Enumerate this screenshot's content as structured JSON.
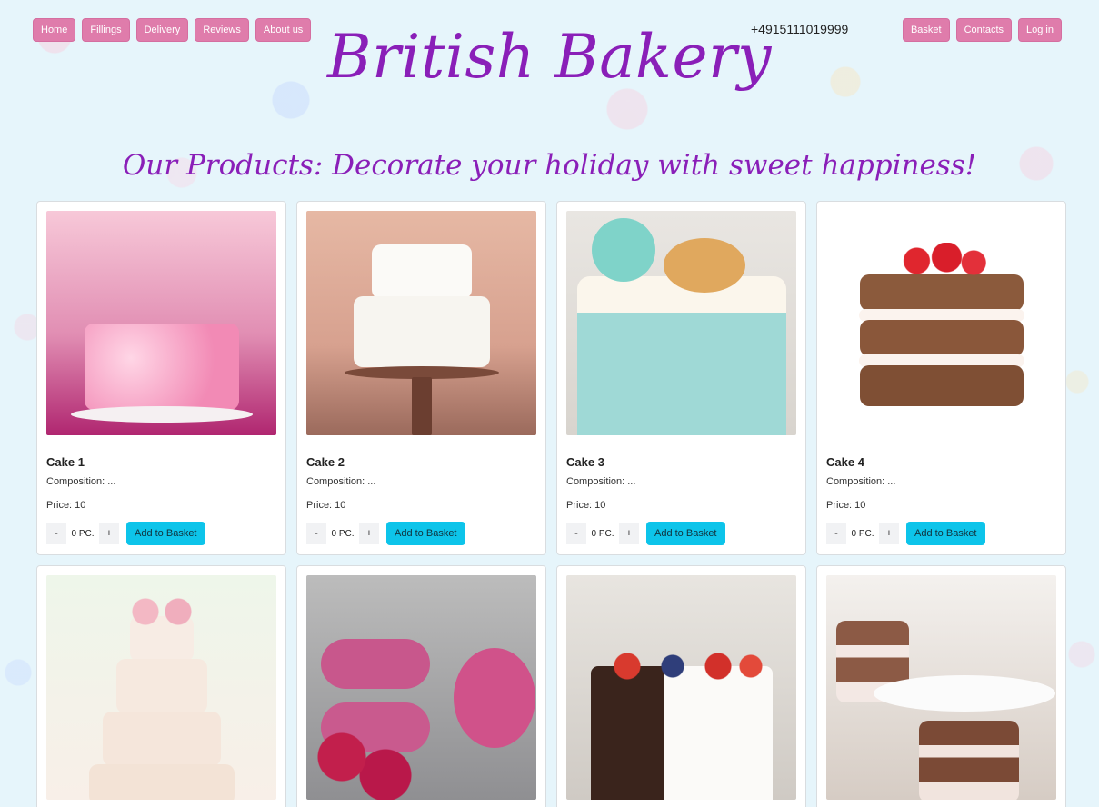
{
  "nav": {
    "left": [
      "Home",
      "Fillings",
      "Delivery",
      "Reviews",
      "About us"
    ],
    "phone": "+4915111019999",
    "right": [
      "Basket",
      "Contacts",
      "Log in"
    ]
  },
  "brand": {
    "title": "British Bakery",
    "tagline": "Our Products: Decorate your holiday with sweet happiness!"
  },
  "labels": {
    "qty_minus": "-",
    "qty_plus": "+",
    "add_to_basket": "Add to Basket"
  },
  "products": [
    {
      "name": "Cake 1",
      "composition": "Composition: ...",
      "price": "Price: 10",
      "quantity": "0 PC."
    },
    {
      "name": "Cake 2",
      "composition": "Composition: ...",
      "price": "Price: 10",
      "quantity": "0 PC."
    },
    {
      "name": "Cake 3",
      "composition": "Composition: ...",
      "price": "Price: 10",
      "quantity": "0 PC."
    },
    {
      "name": "Cake 4",
      "composition": "Composition: ...",
      "price": "Price: 10",
      "quantity": "0 PC."
    }
  ],
  "colors": {
    "nav_button": "#df7cab",
    "brand": "#8a1fb8",
    "add_button": "#0dc4ea"
  }
}
